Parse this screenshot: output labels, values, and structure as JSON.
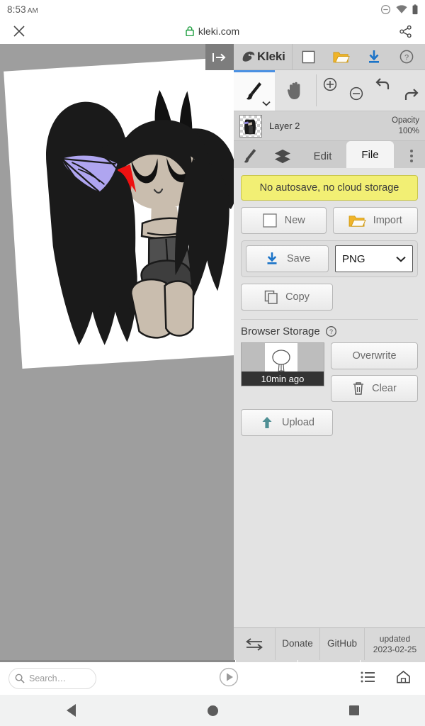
{
  "status_bar": {
    "time": "8:53",
    "ampm": "AM",
    "icons": [
      "do-not-disturb-icon",
      "wifi-icon",
      "battery-icon"
    ]
  },
  "browser": {
    "close_label": "✕",
    "url": "kleki.com",
    "lock_icon": "lock-icon",
    "share_icon": "share-icon",
    "search_placeholder": "Search…",
    "play_icon": "play-icon",
    "tabs_icon": "tab-list-icon",
    "home_icon": "home-icon"
  },
  "app": {
    "collapse_button": "collapse-panel-icon",
    "brand": "Kleki",
    "top_buttons": [
      {
        "name": "new-canvas-icon",
        "label": ""
      },
      {
        "name": "open-file-icon",
        "label": ""
      },
      {
        "name": "download-icon",
        "label": ""
      },
      {
        "name": "help-icon",
        "label": "?"
      }
    ],
    "tools": [
      {
        "name": "brush-tool",
        "active": true
      },
      {
        "name": "hand-tool",
        "active": false
      },
      {
        "name": "zoom-in-tool",
        "active": false
      },
      {
        "name": "zoom-out-tool",
        "active": false
      },
      {
        "name": "undo-tool",
        "active": false
      },
      {
        "name": "redo-tool",
        "active": false
      }
    ],
    "layer": {
      "name": "Layer 2",
      "opacity_label": "Opacity",
      "opacity_value": "100%"
    },
    "tabs": [
      {
        "id": "brush",
        "label": "",
        "icon": "brush-icon",
        "active": false
      },
      {
        "id": "layers",
        "label": "",
        "icon": "layers-icon",
        "active": false
      },
      {
        "id": "edit",
        "label": "Edit",
        "active": false
      },
      {
        "id": "file",
        "label": "File",
        "active": true
      },
      {
        "id": "more",
        "label": "",
        "icon": "more-vertical-icon",
        "active": false
      }
    ],
    "file_panel": {
      "warning": "No autosave, no cloud storage",
      "new_label": "New",
      "import_label": "Import",
      "save_label": "Save",
      "format_value": "PNG",
      "copy_label": "Copy",
      "browser_storage_title": "Browser Storage",
      "browser_storage_help": "?",
      "thumb_caption": "10min ago",
      "overwrite_label": "Overwrite",
      "clear_label": "Clear",
      "upload_label": "Upload"
    },
    "footer": {
      "swap_icon": "swap-arrows-icon",
      "donate_label": "Donate",
      "github_label": "GitHub",
      "updated_line1": "updated",
      "updated_line2": "2023-02-25"
    }
  },
  "colors": {
    "canvas_bg": "#9e9e9e",
    "panel_bg": "#e3e3e3",
    "warning_bg": "#f2ef74",
    "accent_blue": "#4a90e2",
    "download_blue": "#1a73c8",
    "folder_yellow": "#f0b429",
    "lock_green": "#1a9c3c",
    "upload_teal": "#4f8f94"
  },
  "artwork": {
    "description": "chibi character with long black hair, two horns, lavender spiderweb wing, red blood drip, beige skin, dark gray outfit",
    "hair": "#1a1a1a",
    "skin": "#c9bdae",
    "web": "#afa5f0",
    "blood": "#ee1111",
    "outfit": "#4f4f4f",
    "paper": "#ffffff",
    "rotation_deg": -3.6
  }
}
